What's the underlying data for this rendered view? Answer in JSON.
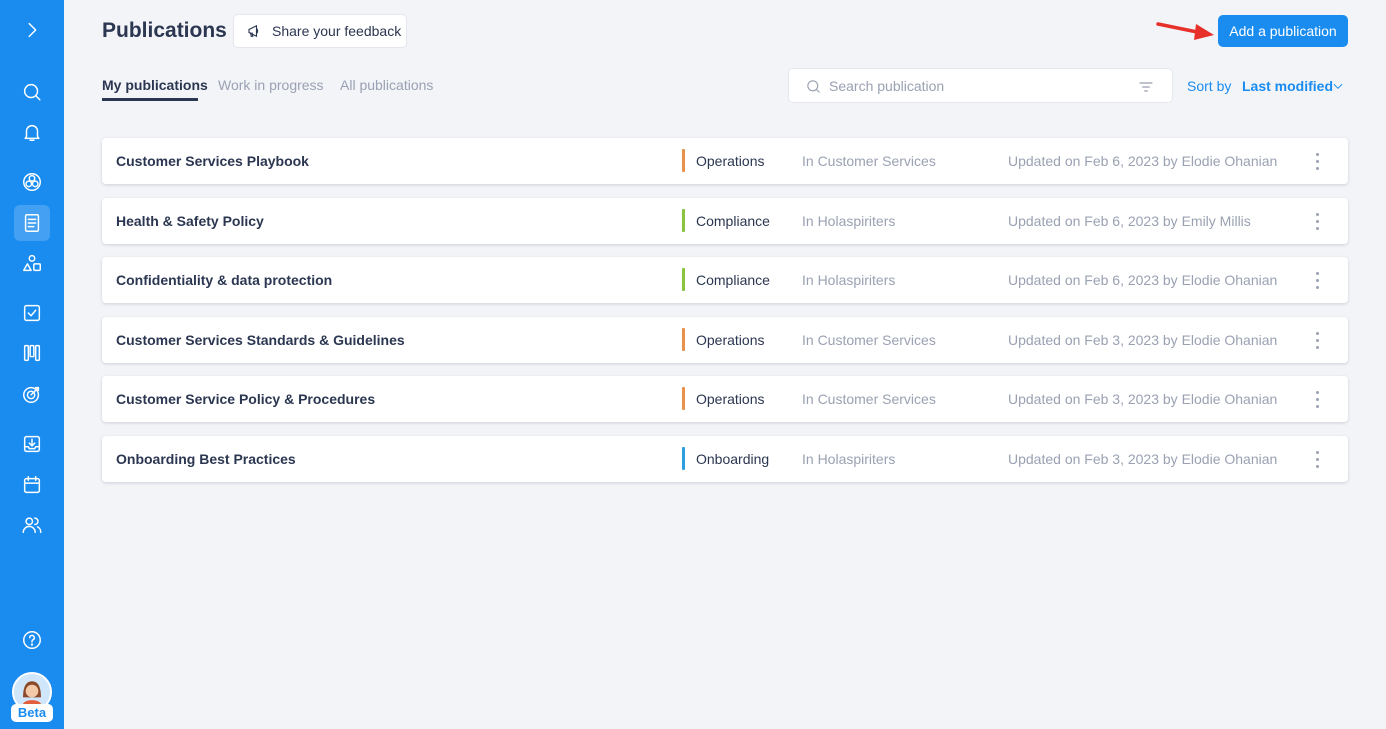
{
  "header": {
    "title": "Publications",
    "feedback_label": "Share your feedback",
    "add_label": "Add a publication"
  },
  "tabs": [
    {
      "label": "My publications",
      "active": true
    },
    {
      "label": "Work in progress",
      "active": false
    },
    {
      "label": "All publications",
      "active": false
    }
  ],
  "search": {
    "placeholder": "Search publication",
    "value": ""
  },
  "sort": {
    "label": "Sort by",
    "value": "Last modified"
  },
  "sidebar": {
    "icons": [
      "expand-icon",
      "search-icon",
      "notification-bell-icon",
      "circles-icon",
      "document-icon",
      "roles-icon",
      "checklist-icon",
      "board-icon",
      "goal-target-icon",
      "inbox-download-icon",
      "calendar-icon",
      "people-icon",
      "help-icon"
    ],
    "beta_label": "Beta"
  },
  "colors": {
    "accent": "#1a8cf0",
    "operations": "#e8914b",
    "compliance": "#8ac43f",
    "onboarding": "#2d9fe0"
  },
  "publications": [
    {
      "title": "Customer Services Playbook",
      "category": "Operations",
      "category_color": "#e8914b",
      "space": "In Customer Services",
      "updated": "Updated on Feb 6, 2023 by Elodie Ohanian"
    },
    {
      "title": "Health & Safety Policy",
      "category": "Compliance",
      "category_color": "#8ac43f",
      "space": "In Holaspiriters",
      "updated": "Updated on Feb 6, 2023 by Emily Millis"
    },
    {
      "title": "Confidentiality & data protection",
      "category": "Compliance",
      "category_color": "#8ac43f",
      "space": "In Holaspiriters",
      "updated": "Updated on Feb 6, 2023 by Elodie Ohanian"
    },
    {
      "title": "Customer Services Standards & Guidelines",
      "category": "Operations",
      "category_color": "#e8914b",
      "space": "In Customer Services",
      "updated": "Updated on Feb 3, 2023 by Elodie Ohanian"
    },
    {
      "title": "Customer Service Policy & Procedures",
      "category": "Operations",
      "category_color": "#e8914b",
      "space": "In Customer Services",
      "updated": "Updated on Feb 3, 2023 by Elodie Ohanian"
    },
    {
      "title": "Onboarding Best Practices",
      "category": "Onboarding",
      "category_color": "#2d9fe0",
      "space": "In Holaspiriters",
      "updated": "Updated on Feb 3, 2023 by Elodie Ohanian"
    }
  ]
}
